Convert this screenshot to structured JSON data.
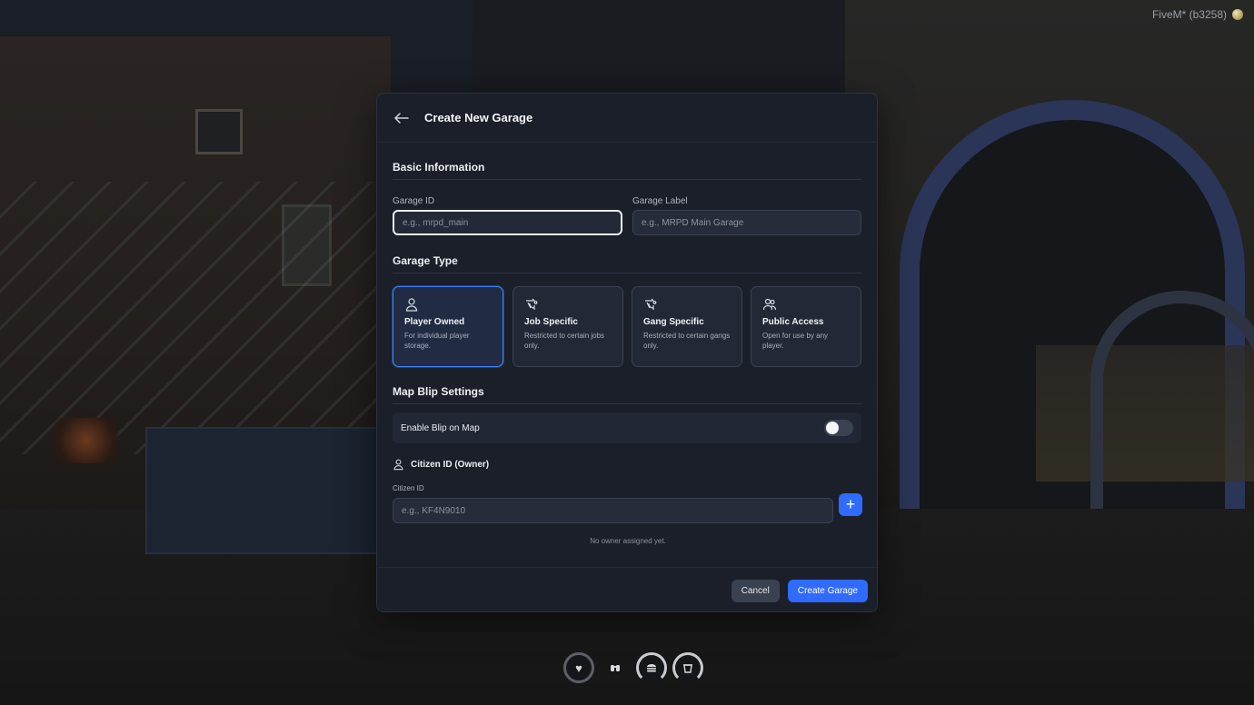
{
  "build_tag": "FiveM* (b3258)",
  "modal": {
    "title": "Create New Garage",
    "basic_info": {
      "heading": "Basic Information",
      "garage_id": {
        "label": "Garage ID",
        "value": "",
        "placeholder": "e.g., mrpd_main"
      },
      "garage_label": {
        "label": "Garage Label",
        "value": "",
        "placeholder": "e.g., MRPD Main Garage"
      }
    },
    "garage_type": {
      "heading": "Garage Type",
      "selected": "Player Owned",
      "options": [
        {
          "title": "Player Owned",
          "desc": "For individual player storage.",
          "icon": "user-icon"
        },
        {
          "title": "Job Specific",
          "desc": "Restricted to certain jobs only.",
          "icon": "job-icon"
        },
        {
          "title": "Gang Specific",
          "desc": "Restricted to certain gangs only.",
          "icon": "gang-icon"
        },
        {
          "title": "Public Access",
          "desc": "Open for use by any player.",
          "icon": "public-icon"
        }
      ]
    },
    "blip": {
      "heading": "Map Blip Settings",
      "enable_label": "Enable Blip on Map",
      "enabled": false
    },
    "owner": {
      "heading": "Citizen ID (Owner)",
      "field_label": "Citizen ID",
      "value": "",
      "placeholder": "e.g., KF4N9010",
      "add_symbol": "+",
      "empty_note": "No owner assigned yet."
    },
    "footer": {
      "cancel_label": "Cancel",
      "create_label": "Create Garage"
    }
  },
  "hud": {
    "items": [
      "heart-icon",
      "binoculars-icon",
      "burger-icon",
      "cup-icon"
    ]
  },
  "colors": {
    "accent": "#2f6bff",
    "modal_bg": "#1b1f29",
    "card_bg": "#232836"
  }
}
